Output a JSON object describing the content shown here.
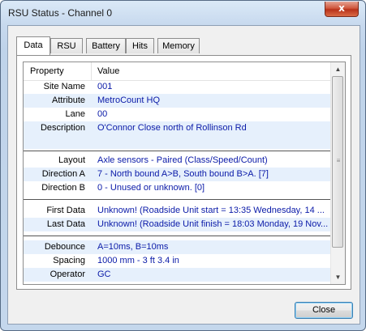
{
  "window": {
    "title": "RSU Status - Channel 0",
    "close_glyph": "x"
  },
  "tabs": [
    {
      "label": "Data",
      "active": true
    },
    {
      "label": "RSU"
    },
    {
      "label": "Battery"
    },
    {
      "label": "Hits"
    },
    {
      "label": "Memory"
    }
  ],
  "grid": {
    "headers": {
      "property": "Property",
      "value": "Value"
    },
    "rows": [
      {
        "property": "Site Name",
        "value": "001"
      },
      {
        "property": "Attribute",
        "value": "MetroCount HQ"
      },
      {
        "property": "Lane",
        "value": "00"
      },
      {
        "property": "Description",
        "value": "O'Connor Close north of Rollinson Rd"
      },
      {
        "property": "Layout",
        "value": "Axle sensors - Paired (Class/Speed/Count)"
      },
      {
        "property": "Direction A",
        "value": "7 - North bound A>B, South bound B>A. [7]"
      },
      {
        "property": "Direction B",
        "value": "0 - Unused or unknown. [0]"
      },
      {
        "property": "First Data",
        "value": "Unknown! (Roadside Unit start = 13:35 Wednesday, 14 ..."
      },
      {
        "property": "Last Data",
        "value": "Unknown! (Roadside Unit finish = 18:03 Monday, 19 Nov..."
      },
      {
        "property": "Debounce",
        "value": "A=10ms, B=10ms"
      },
      {
        "property": "Spacing",
        "value": "1000 mm - 3 ft 3.4 in"
      },
      {
        "property": "Operator",
        "value": "GC"
      }
    ]
  },
  "scrollbar": {
    "up_icon": "arrow-up",
    "down_icon": "arrow-down",
    "grip_icon": "grip"
  },
  "buttons": {
    "close": "Close"
  }
}
